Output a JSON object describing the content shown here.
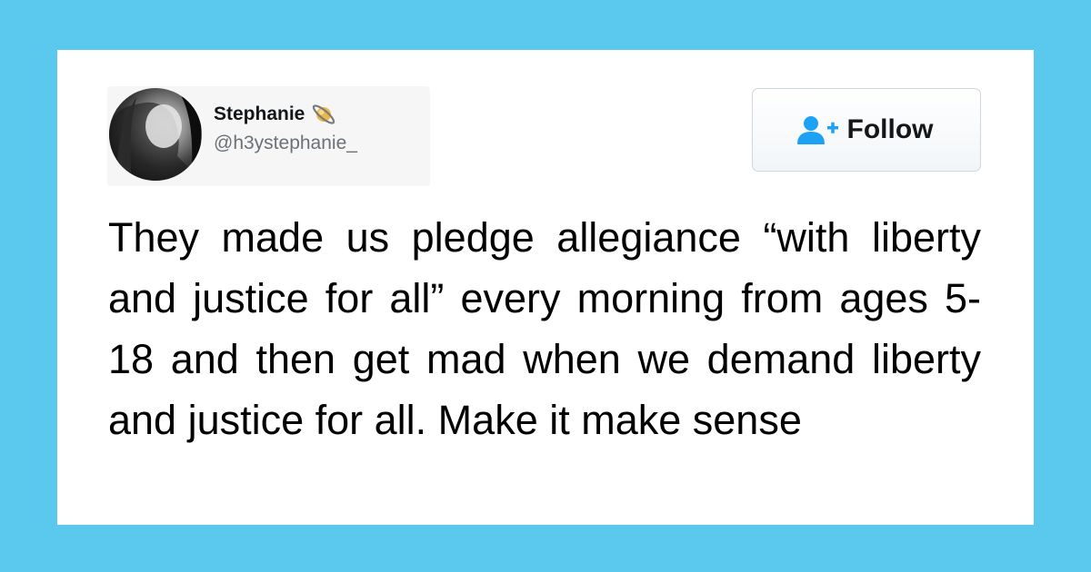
{
  "tweet": {
    "author": {
      "display_name": "Stephanie",
      "handle": "@h3ystephanie_",
      "name_emoji_icon": "ringed-planet-icon",
      "avatar_icon": "profile-photo"
    },
    "follow_button": {
      "label": "Follow",
      "icon": "add-user-icon"
    },
    "text": "They made us pledge allegiance “with liberty and justice for all” every morning from ages 5-18 and then get mad when we demand liberty and justice for all. Make it make sense"
  },
  "colors": {
    "background": "#5bc8ee",
    "card": "#ffffff",
    "accent_blue": "#1da1f2",
    "handle_gray": "#6a7177",
    "text": "#000000"
  }
}
